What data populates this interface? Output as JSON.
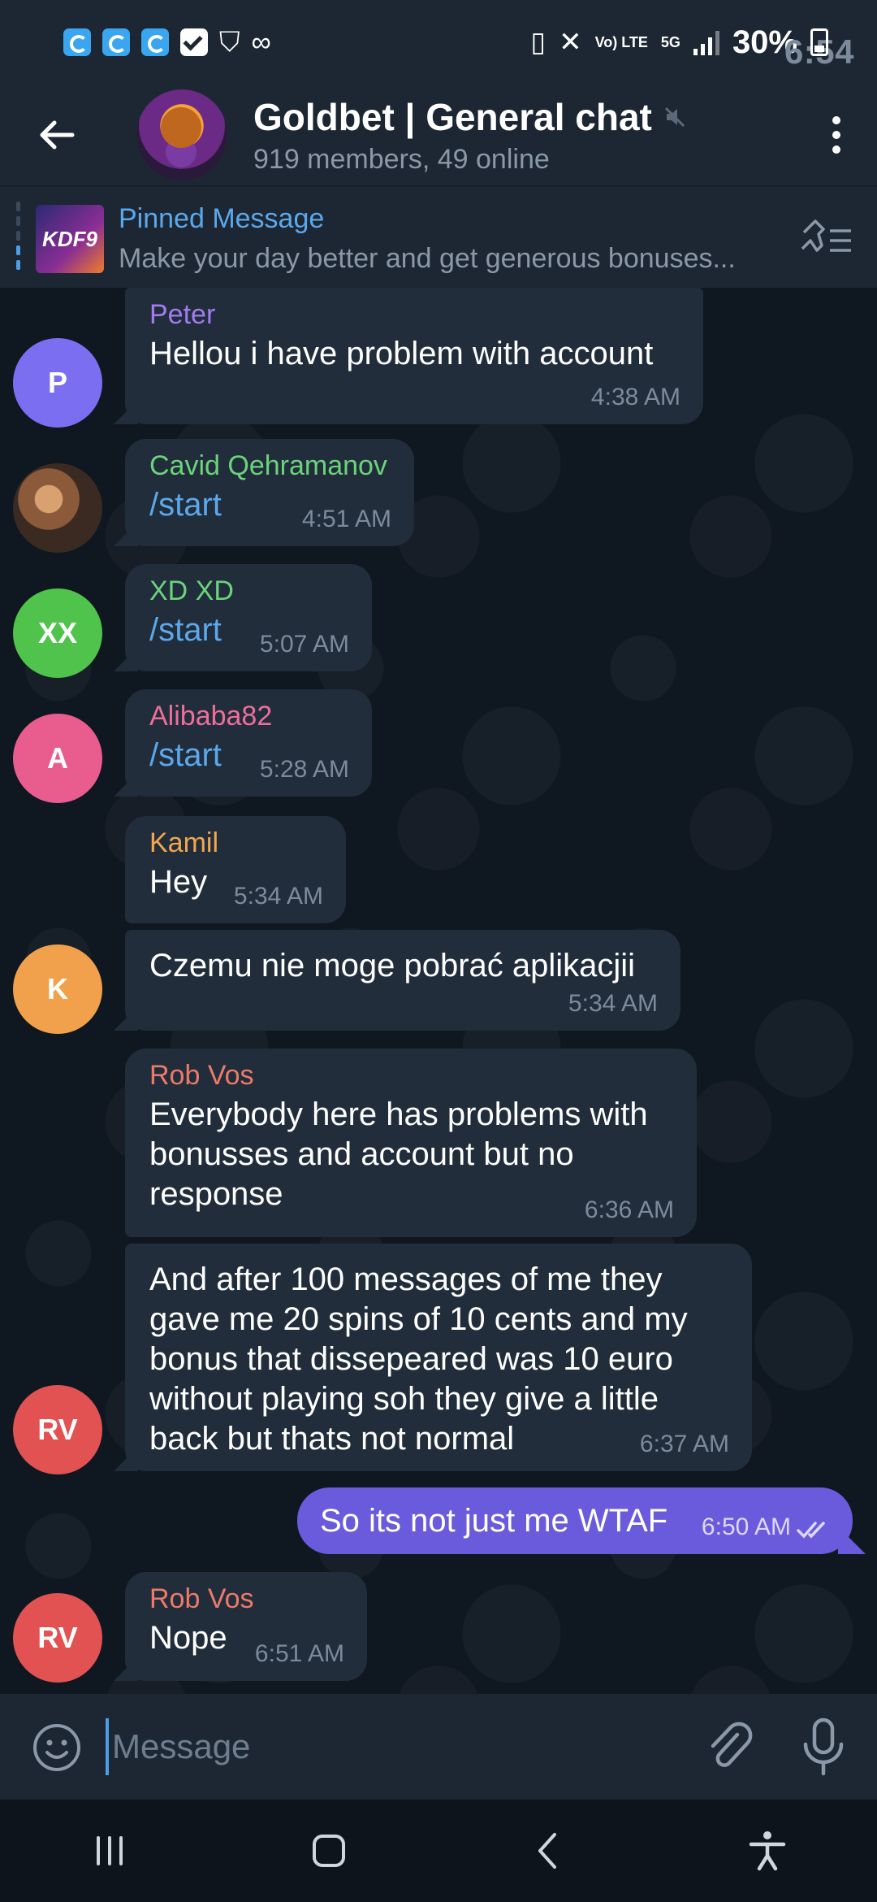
{
  "status_bar": {
    "time": "6:54",
    "battery": "30%",
    "network_5g": "5G",
    "volte": "Vo) LTE"
  },
  "header": {
    "title": "Goldbet | General chat",
    "subtitle": "919 members, 49 online"
  },
  "pinned": {
    "title": "Pinned Message",
    "text": "Make your day better and get generous bonuses...",
    "thumb_text": "KDF9"
  },
  "messages": [
    {
      "sender": "Peter",
      "sender_color": "#a07cf0",
      "text": "Hellou i have problem with account",
      "time": "4:38 AM",
      "avatar": "P",
      "avatar_color": "#7c6ef0"
    },
    {
      "sender": "Cavid Qehramanov",
      "sender_color": "#6bd37a",
      "text": "/start",
      "time": "4:51 AM",
      "avatar": ""
    },
    {
      "sender": "XD XD",
      "sender_color": "#6bd37a",
      "text": "/start",
      "time": "5:07 AM",
      "avatar": "XX",
      "avatar_color": "#4fc34b"
    },
    {
      "sender": "Alibaba82",
      "sender_color": "#ec6f9a",
      "text": "/start",
      "time": "5:28 AM",
      "avatar": "A",
      "avatar_color": "#e85d8d"
    },
    {
      "sender": "Kamil",
      "sender_color": "#f2a64f",
      "text": "Hey",
      "time": "5:34 AM",
      "avatar": ""
    },
    {
      "sender": "",
      "text": "Czemu nie moge pobrać aplikacjii",
      "time": "5:34 AM",
      "avatar": "K",
      "avatar_color": "#f1a14b"
    },
    {
      "sender": "Rob Vos",
      "sender_color": "#ec7a6a",
      "text": "Everybody here has problems with bonusses and account but no response",
      "time": "6:36 AM",
      "avatar": ""
    },
    {
      "sender": "",
      "text": "And after 100 messages of me they gave me 20 spins of 10 cents and my bonus that dissepeared was 10 euro without playing soh they give a little back but thats not normal",
      "time": "6:37 AM",
      "avatar": "RV",
      "avatar_color": "#e25252"
    },
    {
      "sender": "",
      "text": "So its not just me WTAF",
      "time": "6:50 AM",
      "outgoing": true
    },
    {
      "sender": "Rob Vos",
      "sender_color": "#ec7a6a",
      "text": "Nope",
      "time": "6:51 AM",
      "avatar": "RV",
      "avatar_color": "#e25252"
    }
  ],
  "input": {
    "placeholder": "Message"
  },
  "colors": {
    "accent": "#5ba8ec",
    "outgoing_bubble": "#6a5bdc",
    "incoming_bubble": "#212d3b"
  }
}
